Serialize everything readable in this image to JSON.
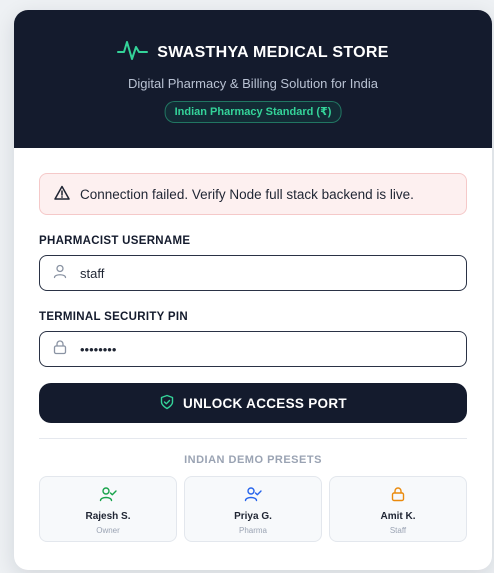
{
  "header": {
    "title": "SWASTHYA MEDICAL STORE",
    "subtitle": "Digital Pharmacy & Billing Solution for India",
    "badge": "Indian Pharmacy Standard (₹)"
  },
  "alert": {
    "message": "Connection failed. Verify Node full stack backend is live."
  },
  "form": {
    "username_label": "PHARMACIST USERNAME",
    "username_value": "staff",
    "pin_label": "TERMINAL SECURITY PIN",
    "pin_value": "12345678",
    "submit_label": "UNLOCK ACCESS PORT"
  },
  "presets": {
    "title": "INDIAN DEMO PRESETS",
    "items": [
      {
        "name": "Rajesh S.",
        "role": "Owner",
        "icon": "user-check-icon",
        "color": "#16a34a"
      },
      {
        "name": "Priya G.",
        "role": "Pharma",
        "icon": "user-check-icon",
        "color": "#2563eb"
      },
      {
        "name": "Amit K.",
        "role": "Staff",
        "icon": "lock-icon",
        "color": "#ea8a0c"
      }
    ]
  },
  "colors": {
    "header_bg": "#141b2d",
    "accent_green": "#34d399",
    "alert_bg": "#fdf0f0"
  }
}
